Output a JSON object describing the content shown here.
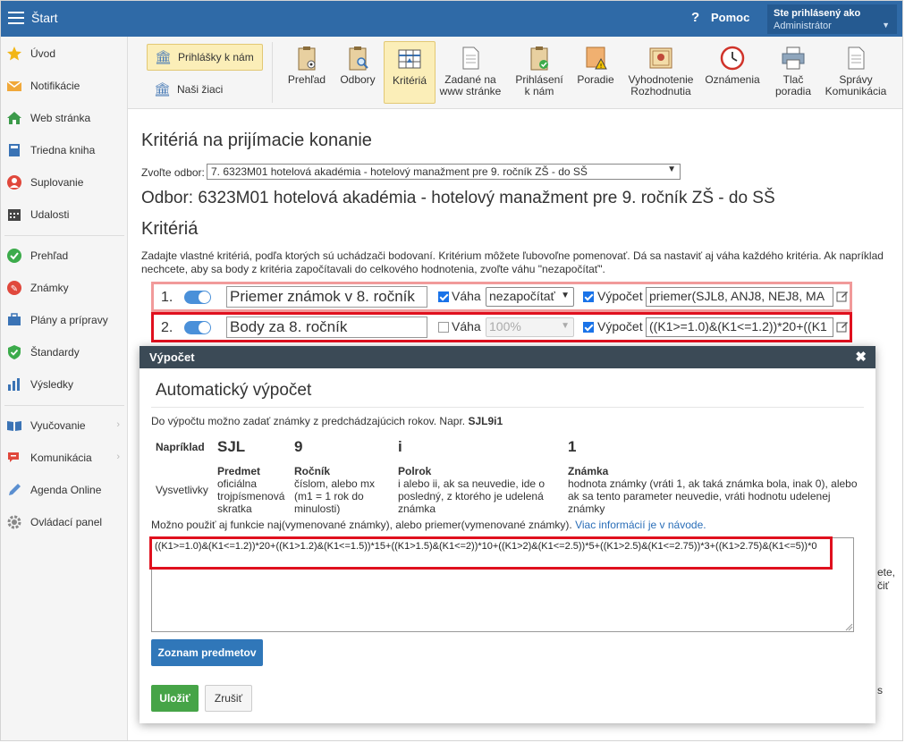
{
  "topbar": {
    "title": "Štart",
    "help_label": "Pomoc",
    "user_line1": "Ste prihlásený ako",
    "user_line2": "Administrátor"
  },
  "sidebar": {
    "items": [
      {
        "label": "Úvod",
        "icon": "star-icon"
      },
      {
        "label": "Notifikácie",
        "icon": "envelope-icon"
      },
      {
        "label": "Web stránka",
        "icon": "home-icon"
      },
      {
        "label": "Triedna kniha",
        "icon": "book-icon"
      },
      {
        "label": "Suplovanie",
        "icon": "person-icon"
      },
      {
        "label": "Udalosti",
        "icon": "calendar-icon"
      },
      {
        "label": "Prehľad",
        "icon": "check-circle-icon"
      },
      {
        "label": "Známky",
        "icon": "grade-icon"
      },
      {
        "label": "Plány a prípravy",
        "icon": "briefcase-icon"
      },
      {
        "label": "Štandardy",
        "icon": "shield-icon"
      },
      {
        "label": "Výsledky",
        "icon": "bar-chart-icon"
      },
      {
        "label": "Vyučovanie",
        "icon": "open-book-icon"
      },
      {
        "label": "Komunikácia",
        "icon": "chat-icon"
      },
      {
        "label": "Agenda Online",
        "icon": "pen-icon"
      },
      {
        "label": "Ovládací panel",
        "icon": "gear-icon"
      }
    ]
  },
  "toolbar": {
    "left": [
      {
        "label": "Prihlášky k nám"
      },
      {
        "label": "Naši žiaci"
      }
    ],
    "buttons": [
      {
        "line1": "Prehľad",
        "line2": ""
      },
      {
        "line1": "Odbory",
        "line2": ""
      },
      {
        "line1": "Kritériá",
        "line2": ""
      },
      {
        "line1": "Zadané na",
        "line2": "www stránke"
      },
      {
        "line1": "Prihlásení",
        "line2": "k nám"
      },
      {
        "line1": "Poradie",
        "line2": ""
      },
      {
        "line1": "Vyhodnotenie",
        "line2": "Rozhodnutia"
      },
      {
        "line1": "Oznámenia",
        "line2": ""
      },
      {
        "line1": "Tlač",
        "line2": "poradia"
      },
      {
        "line1": "Správy",
        "line2": "Komunikácia"
      }
    ]
  },
  "main": {
    "page_title": "Kritériá na prijímacie konanie",
    "odbor_label": "Zvoľte odbor:",
    "odbor_value": "7. 6323M01 hotelová akadémia - hotelový manažment pre 9. ročník ZŠ - do SŠ",
    "odbor_heading": "Odbor: 6323M01 hotelová akadémia - hotelový manažment pre 9. ročník ZŠ - do SŠ",
    "criteria_heading": "Kritériá",
    "criteria_desc": "Zadajte vlastné kritériá, podľa ktorých sú uchádzači bodovaní. Kritérium môžete ľubovoľne pomenovať. Dá sa nastaviť aj váha každého kritéria. Ak napríklad nechcete, aby sa body z kritéria započítavali do celkového hodnotenia, zvoľte váhu \"nezapočítať\".",
    "weight_label": "Váha",
    "calc_label": "Výpočet",
    "criteria": [
      {
        "num": "1.",
        "name": "Priemer známok v 8. ročník",
        "weight": "nezapočítať",
        "formula": "priemer(SJL8, ANJ8, NEJ8, MA"
      },
      {
        "num": "2.",
        "name": "Body za 8. ročník",
        "weight": "100%",
        "formula": "((K1>=1.0)&(K1<=1.2))*20+((K1"
      }
    ],
    "bg_right_1": "ete,",
    "bg_right_2": "čiť",
    "bg_right_3": "s"
  },
  "modal": {
    "header": "Výpočet",
    "title": "Automatický výpočet",
    "intro": "Do výpočtu možno zadať známky z predchádzajúcich rokov. Napr.",
    "intro_example": "SJL9i1",
    "example_label": "Napríklad",
    "explain_label": "Vysvetlivky",
    "columns": [
      {
        "value": "SJL",
        "head": "Predmet",
        "text": "oficiálna trojpísmenová skratka"
      },
      {
        "value": "9",
        "head": "Ročník",
        "text": "číslom, alebo mx (m1 = 1 rok do minulosti)"
      },
      {
        "value": "i",
        "head": "Polrok",
        "text": "i alebo ii, ak sa neuvedie, ide o posledný, z ktorého je udelená známka"
      },
      {
        "value": "1",
        "head": "Známka",
        "text": "hodnota známky (vráti 1, ak taká známka bola, inak 0), alebo ak sa tento parameter neuvedie, vráti hodnotu udelenej známky"
      }
    ],
    "hint": "Možno použiť aj funkcie naj(vymenované známky), alebo priemer(vymenované známky).",
    "hint_link": "Viac informácií je v návode.",
    "formula": "((K1>=1.0)&(K1<=1.2))*20+((K1>1.2)&(K1<=1.5))*15+((K1>1.5)&(K1<=2))*10+((K1>2)&(K1<=2.5))*5+((K1>2.5)&(K1<=2.75))*3+((K1>2.75)&(K1<=5))*0",
    "subjects_button": "Zoznam predmetov",
    "save_button": "Uložiť",
    "cancel_button": "Zrušiť"
  }
}
